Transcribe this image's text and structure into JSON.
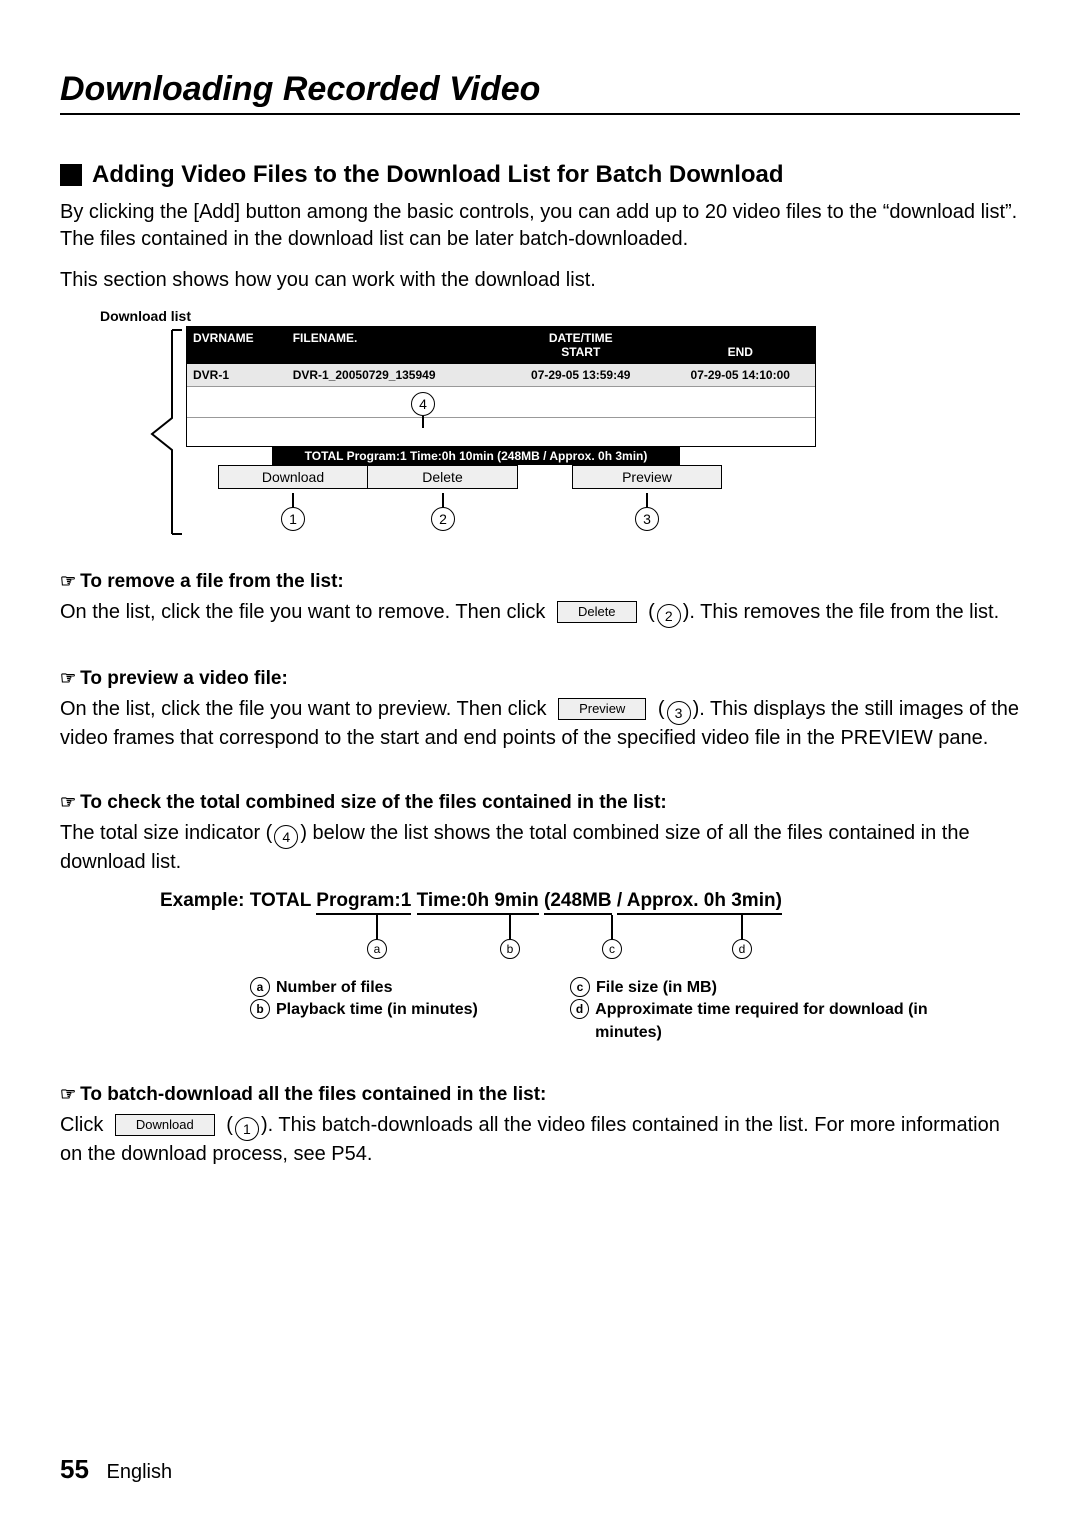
{
  "page_title": "Downloading Recorded Video",
  "section_heading": "Adding Video Files to the Download List for Batch Download",
  "intro_p1": "By clicking the [Add] button among the basic controls, you can add up to 20 video files to the “download list”. The files contained in the download list can be later batch-downloaded.",
  "intro_p2": "This section shows how you can work with the download list.",
  "dl_caption": "Download list",
  "table": {
    "head": {
      "dvr": "DVRNAME",
      "file": "FILENAME.",
      "dt": "DATE/TIME",
      "start": "START",
      "end": "END"
    },
    "row": {
      "dvr": "DVR-1",
      "file": "DVR-1_20050729_135949",
      "start": "07-29-05 13:59:49",
      "end": "07-29-05 14:10:00"
    },
    "total": "TOTAL Program:1 Time:0h 10min (248MB / Approx. 0h 3min)"
  },
  "buttons": {
    "download": "Download",
    "delete": "Delete",
    "preview": "Preview"
  },
  "callouts": {
    "c1": "1",
    "c2": "2",
    "c3": "3",
    "c4": "4",
    "a": "a",
    "b": "b",
    "c": "c",
    "d": "d"
  },
  "sub_remove": "To remove a file from the list:",
  "remove_p_before": "On the list, click the file you want to remove. Then click ",
  "remove_p_after": "). This removes the file from the list.",
  "sub_preview": "To preview a video file:",
  "preview_p_before": "On the list, click the file you want to preview. Then click ",
  "preview_p_after": "). This displays the still images of the video frames that correspond to the start and end points of the specified video file in the PREVIEW pane.",
  "sub_total": "To check the total combined size of the files contained in the list:",
  "total_p_before": "The total size indicator (",
  "total_p_after": ") below the list shows the total combined size of all the files contained in the download list.",
  "example_label": "Example:",
  "example_total": "TOTAL",
  "example_parts": {
    "a": "Program:1",
    "b": "Time:0h 9min",
    "c": "(248MB",
    "d": "/ Approx. 0h 3min)"
  },
  "legend": {
    "a": "Number of files",
    "b": "Playback time (in minutes)",
    "c": "File size (in MB)",
    "d": "Approximate time required for download (in minutes)"
  },
  "sub_batch": "To batch-download all the files contained in the list:",
  "batch_p_before": "Click ",
  "batch_p_after": "). This batch-downloads all the video files contained in the list. For more information on the download process, see P54.",
  "paren_open": " (",
  "footer": {
    "page": "55",
    "lang": "English"
  }
}
